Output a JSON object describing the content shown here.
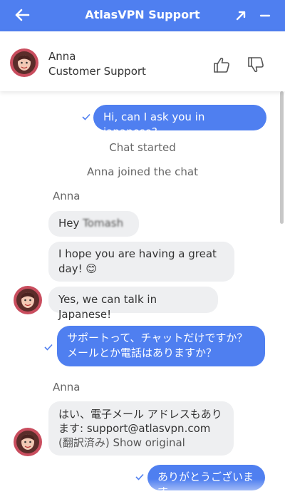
{
  "window": {
    "title": "AtlasVPN Support",
    "icons": {
      "back": "arrow-left-icon",
      "popout": "arrow-up-right-icon",
      "minimize": "minus-icon"
    },
    "accent": "#4f7ff0"
  },
  "agent": {
    "name": "Anna",
    "role": "Customer Support",
    "rate_up_icon": "thumbs-up-icon",
    "rate_down_icon": "thumbs-down-icon"
  },
  "messages": {
    "m1": "Hi, can I ask you in japanese?",
    "sys_started": "Chat started",
    "sys_joined": "Anna joined the chat",
    "sender1": "Anna",
    "m2_greeting": "Hey",
    "m2_name": "Tomash",
    "m3": "I hope you are having a great day!",
    "m3_emoji": "😊",
    "m4": "Yes, we can talk in Japanese!",
    "m5": "サポートって、チャットだけですか？メールとか電話はありますか？",
    "sender2": "Anna",
    "m6_main": "はい、電子メール アドレスもあります: support@atlasvpn.com",
    "m6_note": "(翻訳済み)",
    "m6_link": "Show original",
    "m7": "ありがとうございます。"
  }
}
